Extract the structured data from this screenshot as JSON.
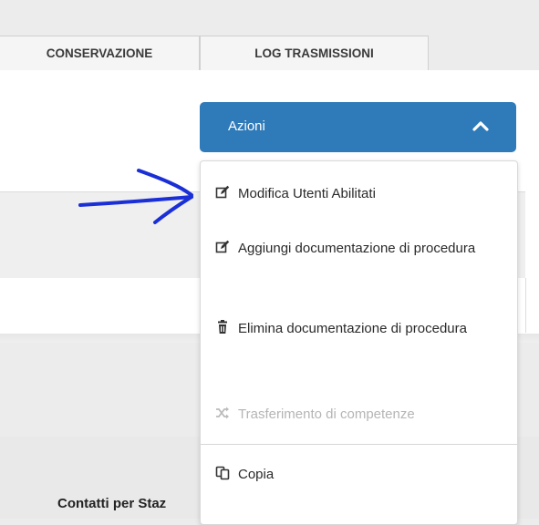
{
  "tabs": [
    {
      "label": "CONSERVAZIONE"
    },
    {
      "label": "LOG TRASMISSIONI"
    }
  ],
  "actions": {
    "label": "Azioni",
    "color": "#2f7ab8"
  },
  "menu": {
    "items": [
      {
        "label": "Modifica Utenti Abilitati",
        "icon": "edit-icon",
        "enabled": true
      },
      {
        "label": "Aggiungi documentazione di procedura",
        "icon": "edit-icon",
        "enabled": true
      },
      {
        "label": "Elimina documentazione di procedura",
        "icon": "trash-icon",
        "enabled": true
      },
      {
        "label": "Trasferimento di competenze",
        "icon": "shuffle-icon",
        "enabled": false
      },
      {
        "label": "Copia",
        "icon": "copy-icon",
        "enabled": true
      }
    ]
  },
  "section": {
    "contacts_label": "Contatti per Staz"
  },
  "annotation": {
    "arrow_color": "#1a2fd6"
  }
}
